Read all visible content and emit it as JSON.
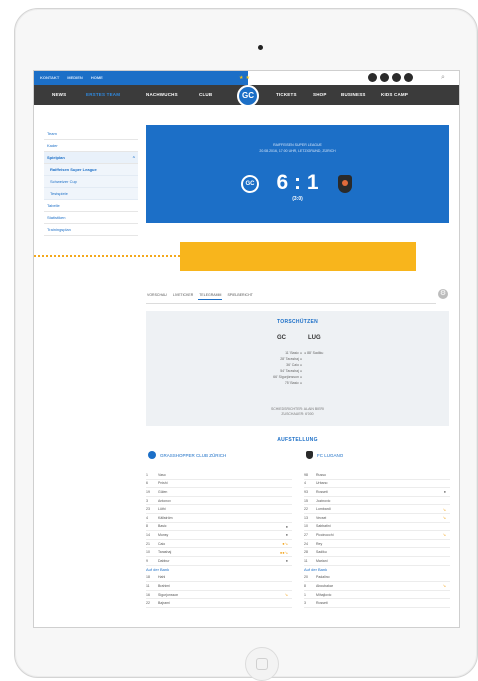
{
  "topbar": {
    "links": [
      "KONTAKT",
      "MEDIEN",
      "HOME"
    ]
  },
  "nav": {
    "items": [
      "NEWS",
      "ERSTES TEAM",
      "NACHWUCHS",
      "CLUB",
      "TICKETS",
      "SHOP",
      "BUSINESS",
      "KIDS CAMP"
    ],
    "active_index": 1
  },
  "sidebar": {
    "items": [
      "Team",
      "Kader",
      "Spielplan",
      "Tabelle",
      "Statistiken",
      "Trainingsplan"
    ],
    "submenu": [
      "Raiffeisen Super League",
      "Schweizer Cup",
      "Testspiele"
    ]
  },
  "match": {
    "league": "RAIFFEISEN SUPER LEAGUE",
    "meta": "20.08.2016, 17:00 UHR, LETZIGRUND, ZÜRICH",
    "score": "6 : 1",
    "halftime": "(3:0)"
  },
  "tabs": [
    "VORSCHAU",
    "LIVETICKER",
    "TELEGRAMM",
    "SPIELBERICHT"
  ],
  "goals": {
    "title": "TORSCHÜTZEN",
    "home_abbr": "GC",
    "away_abbr": "LUG",
    "home_scorers": [
      "11' Basic",
      "28' Tarashaj",
      "36' Caio",
      "54' Tarashaj",
      "66' Sigurjónsson",
      "75' Basic"
    ],
    "away_scorers": [
      "88' Sadiku"
    ],
    "referee_label": "SCHIEDSRICHTER: ALAIN BIERI",
    "attendance": "ZUSCHAUER: 6'000"
  },
  "lineup": {
    "title": "AUFSTELLUNG",
    "home_team": "GRASSHOPPER CLUB ZÜRICH",
    "away_team": "FC LUGANO",
    "bench_label": "Auf der Bank",
    "home_players": [
      {
        "num": "1",
        "name": "Vaso",
        "mark": ""
      },
      {
        "num": "6",
        "name": "Pnishi",
        "mark": ""
      },
      {
        "num": "19",
        "name": "Gülen",
        "mark": ""
      },
      {
        "num": "3",
        "name": "Antonov",
        "mark": ""
      },
      {
        "num": "23",
        "name": "Lüthi",
        "mark": ""
      },
      {
        "num": "4",
        "name": "Källström",
        "mark": ""
      },
      {
        "num": "8",
        "name": "Basic",
        "mark": "●"
      },
      {
        "num": "14",
        "name": "Munsy",
        "mark": "●"
      },
      {
        "num": "21",
        "name": "Caio",
        "mark": "●↘"
      },
      {
        "num": "10",
        "name": "Tarashaj",
        "mark": "●●↘"
      },
      {
        "num": "9",
        "name": "Dabbur",
        "mark": "●"
      }
    ],
    "home_bench": [
      {
        "num": "18",
        "name": "Hahl",
        "mark": ""
      },
      {
        "num": "11",
        "name": "Brahimi",
        "mark": ""
      },
      {
        "num": "16",
        "name": "Sigurjonsson",
        "mark": "↘"
      },
      {
        "num": "22",
        "name": "Bajrami",
        "mark": ""
      }
    ],
    "away_players": [
      {
        "num": "98",
        "name": "Russo",
        "mark": ""
      },
      {
        "num": "4",
        "name": "Urbano",
        "mark": ""
      },
      {
        "num": "93",
        "name": "Rosseti",
        "mark": "●"
      },
      {
        "num": "15",
        "name": "Jozinovic",
        "mark": ""
      },
      {
        "num": "22",
        "name": "Lombardi",
        "mark": "↘"
      },
      {
        "num": "13",
        "name": "Vecsei",
        "mark": "↘"
      },
      {
        "num": "10",
        "name": "Sabbatini",
        "mark": ""
      },
      {
        "num": "27",
        "name": "Piccinocchi",
        "mark": "↘"
      },
      {
        "num": "24",
        "name": "Rey",
        "mark": ""
      },
      {
        "num": "28",
        "name": "Sadiku",
        "mark": ""
      },
      {
        "num": "11",
        "name": "Mariani",
        "mark": ""
      }
    ],
    "away_bench": [
      {
        "num": "20",
        "name": "Padalino",
        "mark": ""
      },
      {
        "num": "8",
        "name": "Aboubakar",
        "mark": "↘"
      },
      {
        "num": "1",
        "name": "Mihajlovic",
        "mark": ""
      },
      {
        "num": "3",
        "name": "Rosseti",
        "mark": ""
      }
    ]
  },
  "colors": {
    "primary": "#1c6fc7",
    "accent": "#f8b51c",
    "nav": "#3b3b3b"
  }
}
